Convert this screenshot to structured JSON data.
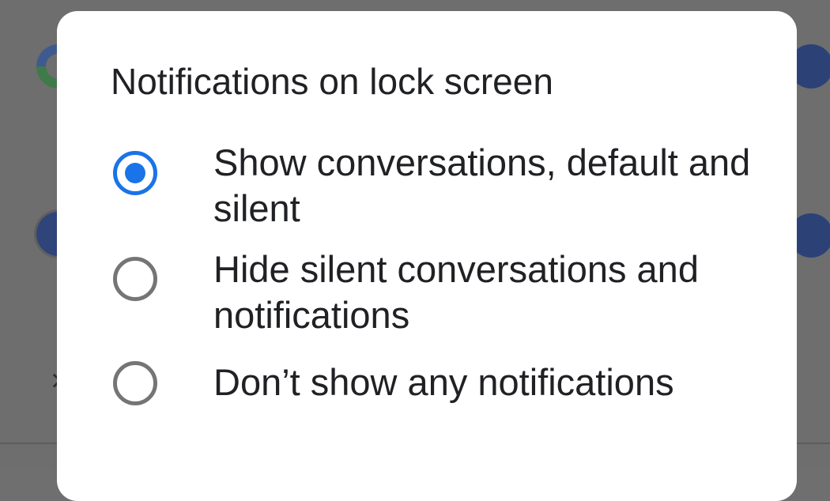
{
  "dialog": {
    "title": "Notifications on lock screen",
    "options": [
      {
        "label": "Show conversations, default and silent",
        "selected": true
      },
      {
        "label": "Hide silent conversations and notifications",
        "selected": false
      },
      {
        "label": "Don’t show any notifications",
        "selected": false
      }
    ]
  },
  "background": {
    "icons": [
      "google-icon",
      "clock-icon",
      "avatar-icon",
      "avatar-icon",
      "close-icon"
    ],
    "close_glyph": "×"
  },
  "colors": {
    "accent": "#1a73e8",
    "radio_unselected": "#757575",
    "text": "#202124",
    "scrim": "#6e6e6e",
    "dialog_bg": "#ffffff"
  }
}
